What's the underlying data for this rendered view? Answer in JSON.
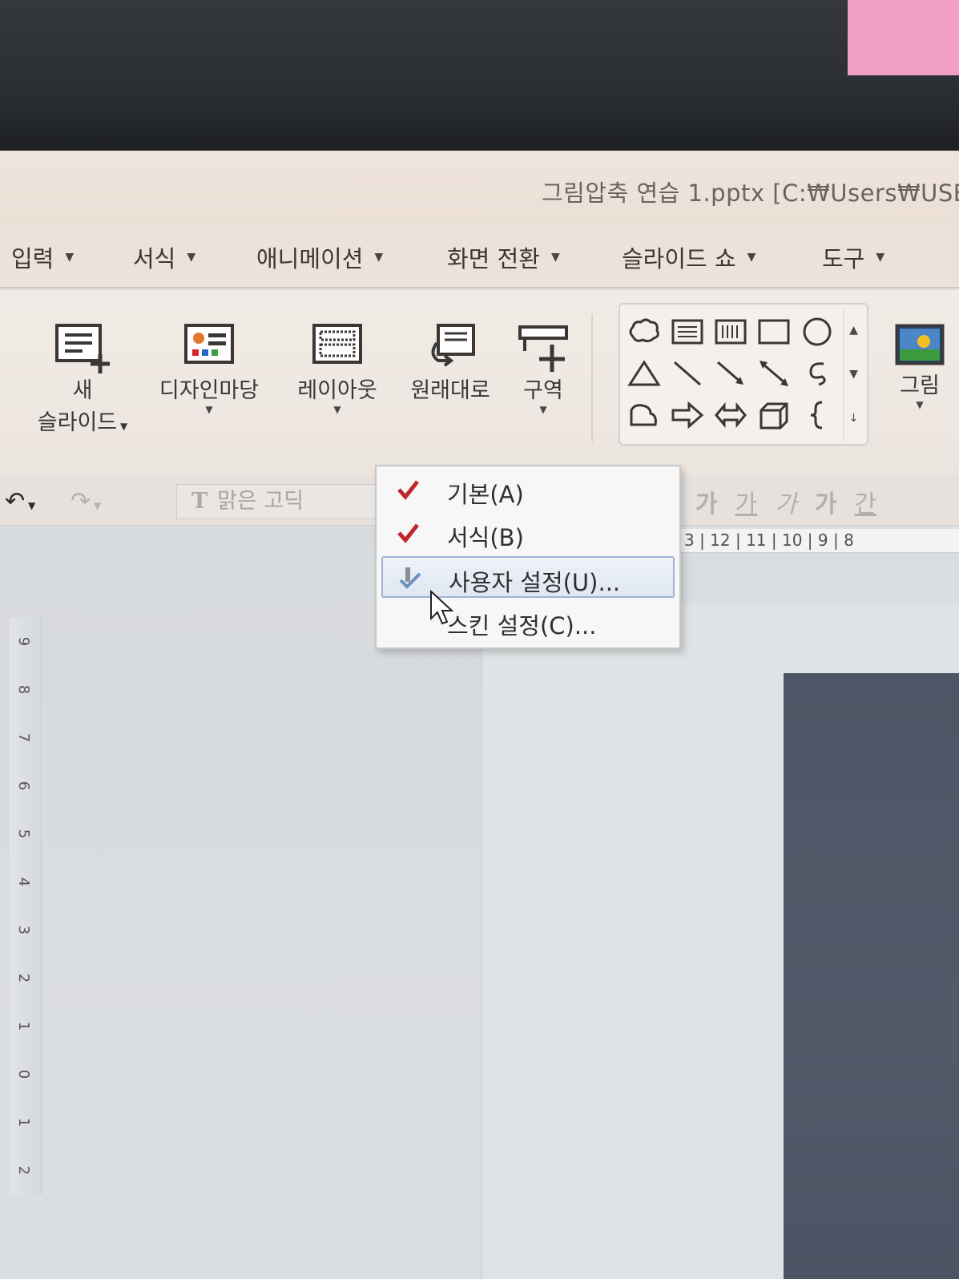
{
  "window": {
    "title": "그림압축 연습 1.pptx [C:₩Users₩USE"
  },
  "menubar": {
    "items": [
      {
        "label": "입력"
      },
      {
        "label": "서식"
      },
      {
        "label": "애니메이션"
      },
      {
        "label": "화면 전환"
      },
      {
        "label": "슬라이드 쇼"
      },
      {
        "label": "도구"
      }
    ]
  },
  "ribbon": {
    "new_slide": {
      "line1": "새",
      "line2": "슬라이드"
    },
    "design": {
      "label": "디자인마당"
    },
    "layout": {
      "label": "레이아웃"
    },
    "reset": {
      "label": "원래대로"
    },
    "section": {
      "label": "구역"
    },
    "picture": {
      "label": "그림"
    }
  },
  "format_toolbar": {
    "font_name": "맑은 고딕",
    "styles": [
      "가",
      "가",
      "가",
      "가",
      "간"
    ]
  },
  "ruler": {
    "horizontal": "3 | 12 | 11 | 10 | 9 | 8",
    "vertical": [
      "9",
      "8",
      "7",
      "6",
      "5",
      "4",
      "3",
      "2",
      "1",
      "0",
      "1",
      "2"
    ]
  },
  "dropdown_menu": {
    "items": [
      {
        "label": "기본(A)",
        "checked": true
      },
      {
        "label": "서식(B)",
        "checked": true
      },
      {
        "label": "사용자 설정(U)...",
        "checked": false,
        "highlighted": true
      },
      {
        "label": "스킨 설정(C)...",
        "checked": false
      }
    ]
  },
  "colors": {
    "checkmark": "#c0262d",
    "highlight_border": "#9fb3d1",
    "sticky_note": "#f2a0c8"
  }
}
